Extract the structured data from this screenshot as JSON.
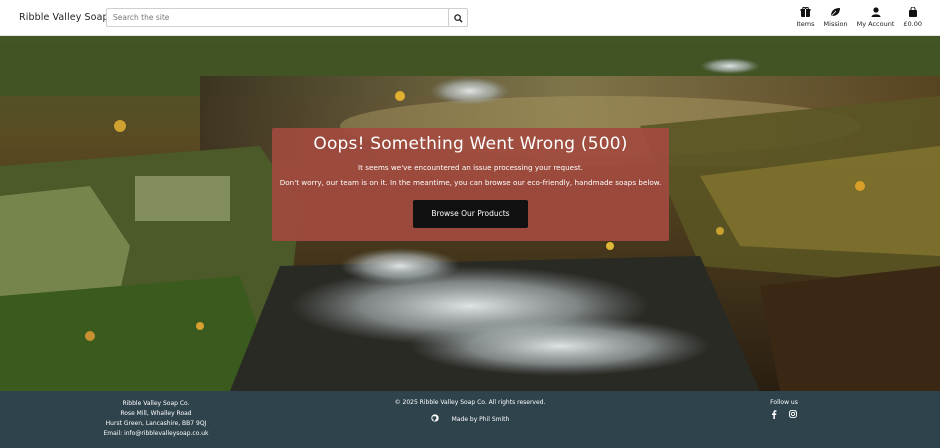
{
  "header": {
    "brand": "Ribble Valley Soap Co.",
    "search_placeholder": "Search the site",
    "nav": [
      {
        "label": "Items",
        "icon": "gift-icon"
      },
      {
        "label": "Mission",
        "icon": "leaf-icon"
      },
      {
        "label": "My Account",
        "icon": "user-icon"
      },
      {
        "label": "£0.00",
        "icon": "shopping-bag-icon"
      }
    ]
  },
  "error": {
    "title": "Oops! Something Went Wrong (500)",
    "line1": "It seems we've encountered an issue processing your request.",
    "line2": "Don't worry, our team is on it. In the meantime, you can browse our eco-friendly, handmade soaps below.",
    "button": "Browse Our Products"
  },
  "footer": {
    "address": [
      "Ribble Valley Soap Co.",
      "Rose Mill, Whalley Road",
      "Hurst Green, Lancashire, BB7 9QJ",
      "Email: info@ribblevalleysoap.co.uk"
    ],
    "copyright": "© 2025 Ribble Valley Soap Co. All rights reserved.",
    "made_by": "Made by Phil Smith",
    "follow": "Follow us"
  },
  "colors": {
    "card": "#a04a3e",
    "footer": "#2f434d",
    "button": "#111111"
  }
}
